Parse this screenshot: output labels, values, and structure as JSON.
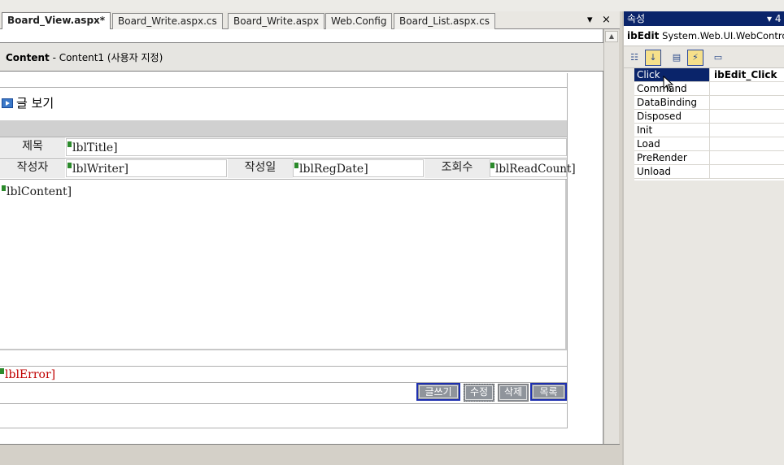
{
  "tabs": [
    {
      "label": "Board_View.aspx*",
      "active": true
    },
    {
      "label": "Board_Write.aspx.cs"
    },
    {
      "label": "Board_Write.aspx"
    },
    {
      "label": "Web.Config"
    },
    {
      "label": "Board_List.aspx.cs"
    }
  ],
  "tab_controls": {
    "dropdown": "▾",
    "close": "×"
  },
  "designer": {
    "content_header_bold": "Content",
    "content_header_rest": " - Content1 (사용자 지정)",
    "section_title": "글 보기",
    "row1": {
      "label": "제목",
      "field": "lblTitle]"
    },
    "row2": {
      "writer_label": "작성자",
      "writer_field": "lblWriter]",
      "date_label": "작성일",
      "date_field": "lblRegDate]",
      "read_label": "조회수",
      "read_field": "lblReadCount]"
    },
    "content_field": "lblContent]",
    "error_field": "lblError]",
    "buttons": {
      "write": "글쓰기",
      "edit": "수정",
      "delete": "삭제",
      "list": "목록"
    }
  },
  "properties": {
    "title": "속성",
    "title_pin": "▾ 4",
    "object_name": "ibEdit",
    "object_type": "System.Web.UI.WebControls",
    "events": [
      {
        "name": "Click",
        "value": "ibEdit_Click",
        "selected": true
      },
      {
        "name": "Command",
        "value": ""
      },
      {
        "name": "DataBinding",
        "value": ""
      },
      {
        "name": "Disposed",
        "value": ""
      },
      {
        "name": "Init",
        "value": ""
      },
      {
        "name": "Load",
        "value": ""
      },
      {
        "name": "PreRender",
        "value": ""
      },
      {
        "name": "Unload",
        "value": ""
      }
    ]
  },
  "colors": {
    "selection": "#0a246a",
    "error_label": "#c00000",
    "button_border": "#1d2fb0"
  }
}
